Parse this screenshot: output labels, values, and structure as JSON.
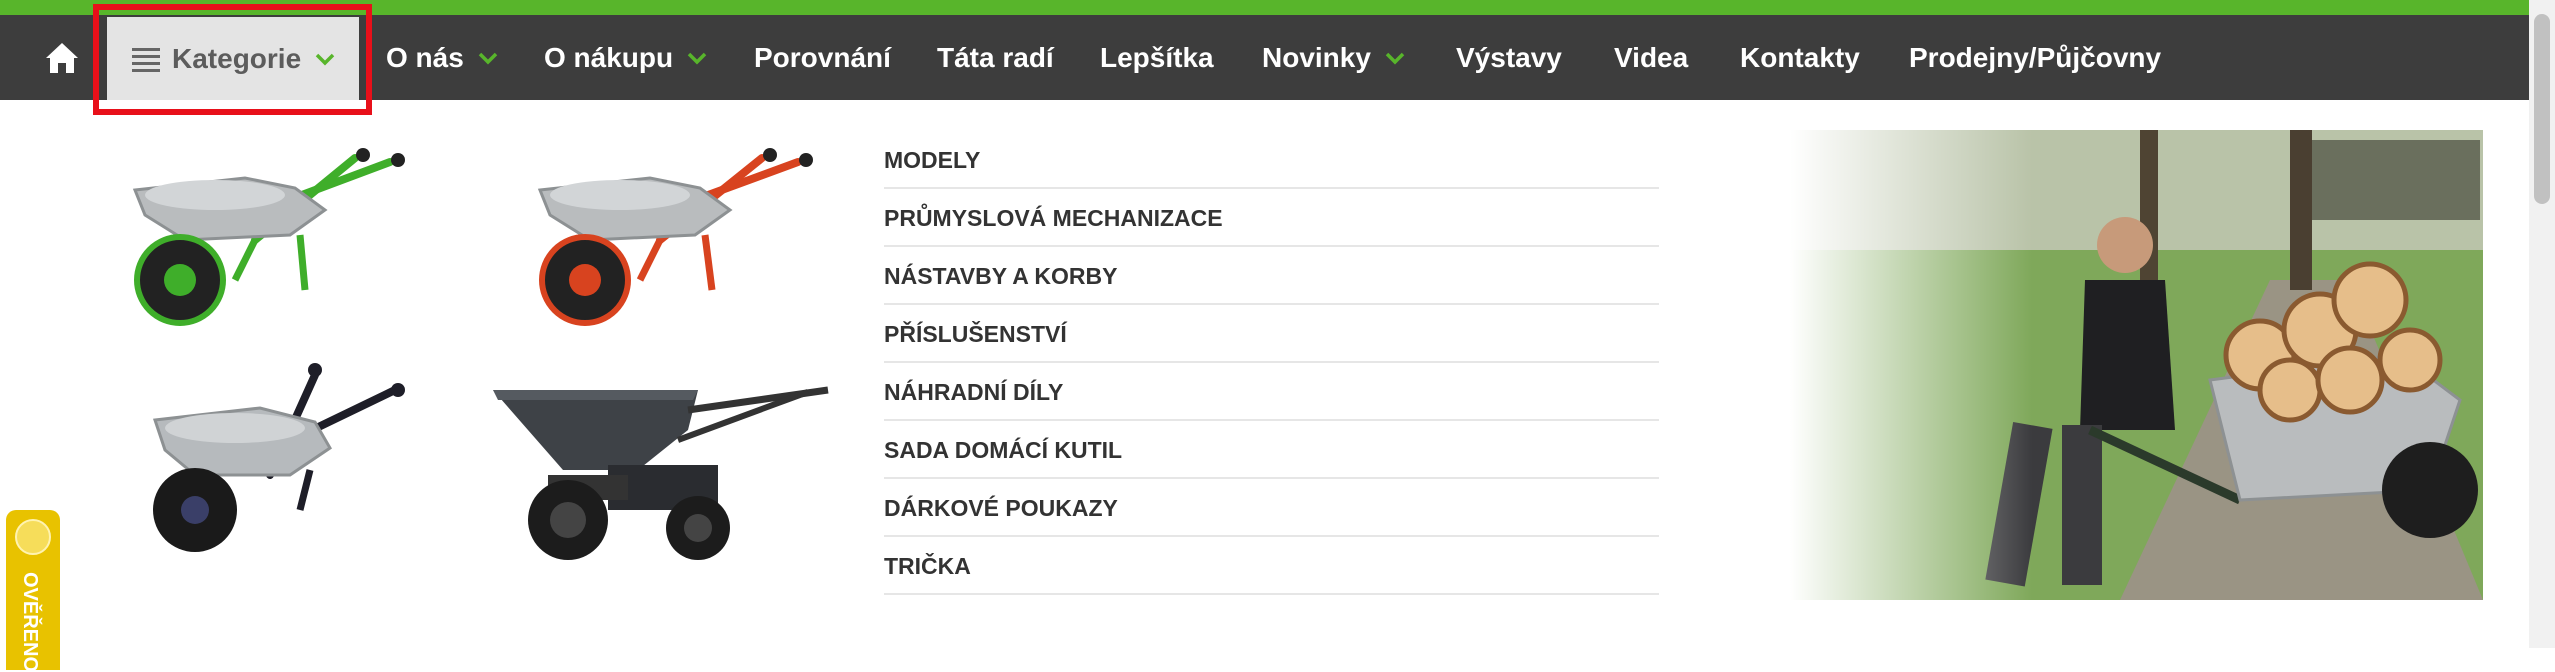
{
  "nav": {
    "home_icon": "home-icon",
    "items": [
      {
        "label": "Kategorie",
        "has_dropdown": true
      },
      {
        "label": "O nás",
        "has_dropdown": true
      },
      {
        "label": "O nákupu",
        "has_dropdown": true
      },
      {
        "label": "Porovnání",
        "has_dropdown": false
      },
      {
        "label": "Táta radí",
        "has_dropdown": false
      },
      {
        "label": "Lepšítka",
        "has_dropdown": false
      },
      {
        "label": "Novinky",
        "has_dropdown": true
      },
      {
        "label": "Výstavy",
        "has_dropdown": false
      },
      {
        "label": "Videa",
        "has_dropdown": false
      },
      {
        "label": "Kontakty",
        "has_dropdown": false
      },
      {
        "label": "Prodejny/Půjčovny",
        "has_dropdown": false
      }
    ]
  },
  "mega_menu": {
    "categories": [
      "MODELY",
      "PRŮMYSLOVÁ MECHANIZACE",
      "NÁSTAVBY A KORBY",
      "PŘÍSLUŠENSTVÍ",
      "NÁHRADNÍ DÍLY",
      "SADA DOMÁCÍ KUTIL",
      "DÁRKOVÉ POUKAZY",
      "TRIČKA"
    ],
    "products": [
      {
        "icon": "wheelbarrow-green-image"
      },
      {
        "icon": "wheelbarrow-red-image"
      },
      {
        "icon": "wheelbarrow-black-image"
      },
      {
        "icon": "motorized-dumper-image"
      }
    ],
    "hero_icon": "man-pushing-wheelbarrow-photo"
  },
  "badge": {
    "label": "OVĚŘENO"
  },
  "colors": {
    "accent": "#58b52b",
    "nav_bg": "#3d3d3d",
    "active_bg": "#e4e4e4",
    "highlight": "#e8101a",
    "badge": "#e8c200"
  }
}
